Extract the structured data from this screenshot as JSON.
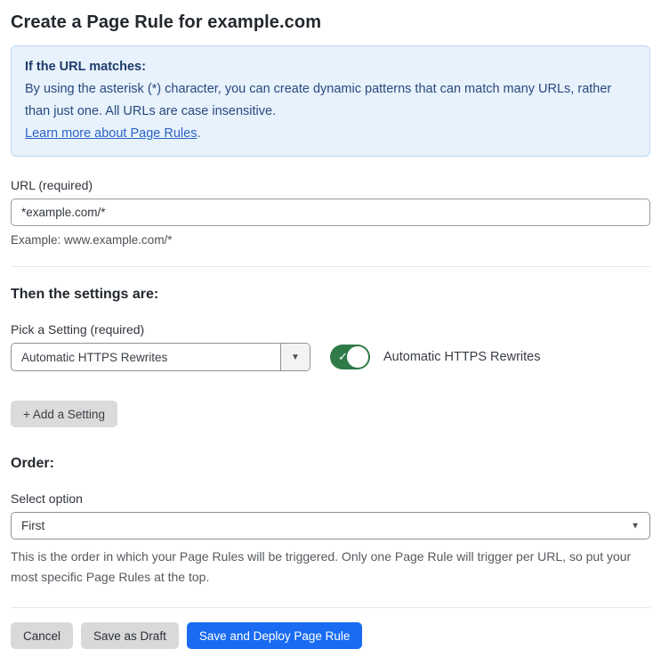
{
  "page": {
    "title": "Create a Page Rule for example.com"
  },
  "info_box": {
    "heading": "If the URL matches:",
    "body": "By using the asterisk (*) character, you can create dynamic patterns that can match many URLs, rather than just one. All URLs are case insensitive.",
    "link_text": "Learn more about Page Rules",
    "link_suffix": "."
  },
  "url_field": {
    "label": "URL (required)",
    "value": "*example.com/*",
    "helper": "Example: www.example.com/*"
  },
  "settings_section": {
    "heading": "Then the settings are:",
    "picker_label": "Pick a Setting (required)",
    "picker_value": "Automatic HTTPS Rewrites",
    "picker_caret": "▼",
    "toggle_state": "on",
    "toggle_check": "✓",
    "toggle_label": "Automatic HTTPS Rewrites",
    "add_button_label": "+ Add a Setting"
  },
  "order_section": {
    "heading": "Order:",
    "select_label": "Select option",
    "select_value": "First",
    "select_caret": "▼",
    "helper": "This is the order in which your Page Rules will be triggered. Only one Page Rule will trigger per URL, so put your most specific Page Rules at the top."
  },
  "footer": {
    "cancel_label": "Cancel",
    "save_draft_label": "Save as Draft",
    "save_deploy_label": "Save and Deploy Page Rule"
  },
  "colors": {
    "info_bg": "#e8f2fc",
    "info_border": "#bfd9f3",
    "info_text": "#28497e",
    "link_blue": "#2b62c4",
    "toggle_green": "#2f7b47",
    "primary_blue": "#1a6bf2",
    "button_gray": "#d9d9d9"
  }
}
